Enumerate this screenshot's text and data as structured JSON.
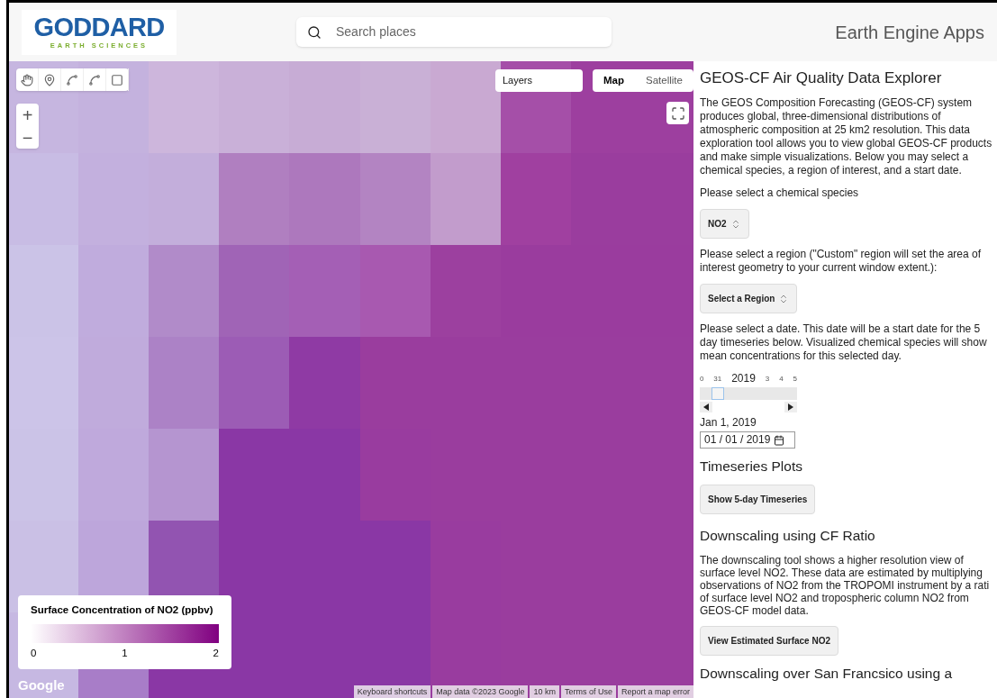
{
  "header": {
    "logo": {
      "main": "GODDARD",
      "sub": "EARTH SCIENCES"
    },
    "search": {
      "placeholder": "Search places"
    },
    "app_name": "Earth Engine Apps"
  },
  "map": {
    "layers_button": "Layers",
    "map_types": [
      {
        "label": "Map",
        "selected": true
      },
      {
        "label": "Satellite",
        "selected": false
      }
    ],
    "zoom": [
      "+",
      "−"
    ],
    "legend": {
      "title": "Surface Concentration of NO2 (ppbv)",
      "ticks": [
        "0",
        "1",
        "2"
      ]
    },
    "google": "Google",
    "attribution": [
      "Keyboard shortcuts",
      "Map data ©2023 Google",
      "10 km",
      "Terms of Use",
      "Report a map error"
    ]
  },
  "panel": {
    "title": "GEOS-CF Air Quality Data Explorer",
    "intro": "The GEOS Composition Forecasting (GEOS-CF) system produces global, three-dimensional distributions of atmospheric composition at 25 km2 resolution. This data exploration tool allows you to view global GEOS-CF products and make simple visualizations. Below you may select a chemical species, a region of interest, and a start date.",
    "species_label": "Please select a chemical species",
    "species_select": "NO2",
    "region_label": "Please select a region (\"Custom\" region will set the area of interest geometry to your current window extent.):",
    "region_select": "Select a Region",
    "date_label": "Please select a date. This date will be a start date for the 5 day timeseries below. Visualized chemical species will show mean concentrations for this selected day.",
    "date_slider": {
      "labels": [
        "0",
        "31",
        "2019",
        "3",
        "4",
        "5"
      ],
      "level": 0.12
    },
    "date_text": "Jan 1, 2019",
    "date_input": "01 / 01 / 2019",
    "timeseries_heading": "Timeseries Plots",
    "timeseries_button": "Show 5-day Timeseries",
    "downscaling_heading": "Downscaling using CF Ratio",
    "downscaling_text": "The downscaling tool shows a higher resolution view of surface level NO2. These data are estimated by multiplying observations of NO2 from the TROPOMI instrument by a rati of surface level NO2 and tropospheric column NO2 from GEOS-CF model data.",
    "downscaling_button": "View Estimated Surface NO2",
    "regression_heading": "Downscaling over San Francsico using a"
  }
}
